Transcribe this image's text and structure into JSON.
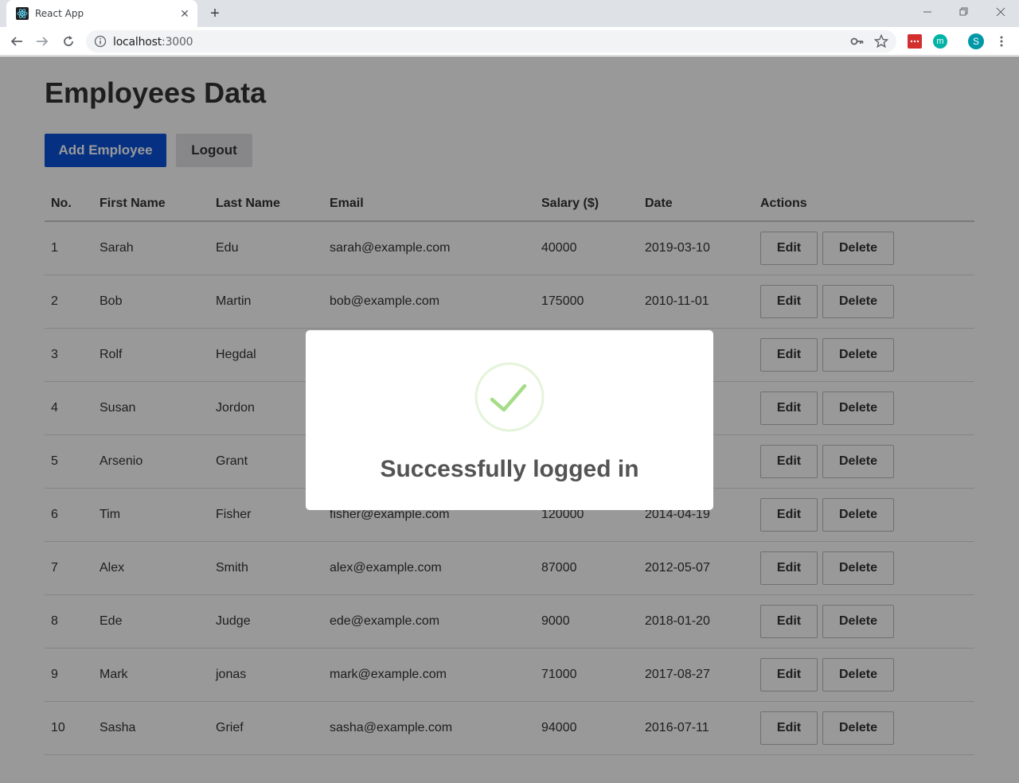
{
  "browser": {
    "tab_title": "React App",
    "url_host": "localhost",
    "url_port": ":3000",
    "profile_initial": "S",
    "extension_m": "m"
  },
  "page": {
    "title": "Employees Data",
    "add_button": "Add Employee",
    "logout_button": "Logout",
    "columns": [
      "No.",
      "First Name",
      "Last Name",
      "Email",
      "Salary ($)",
      "Date",
      "Actions"
    ],
    "edit_label": "Edit",
    "delete_label": "Delete",
    "rows": [
      {
        "no": "1",
        "first": "Sarah",
        "last": "Edu",
        "email": "sarah@example.com",
        "salary": "40000",
        "date": "2019-03-10"
      },
      {
        "no": "2",
        "first": "Bob",
        "last": "Martin",
        "email": "bob@example.com",
        "salary": "175000",
        "date": "2010-11-01"
      },
      {
        "no": "3",
        "first": "Rolf",
        "last": "Hegdal",
        "email": "",
        "salary": "",
        "date": ""
      },
      {
        "no": "4",
        "first": "Susan",
        "last": "Jordon",
        "email": "",
        "salary": "",
        "date": ""
      },
      {
        "no": "5",
        "first": "Arsenio",
        "last": "Grant",
        "email": "",
        "salary": "",
        "date": ""
      },
      {
        "no": "6",
        "first": "Tim",
        "last": "Fisher",
        "email": "fisher@example.com",
        "salary": "120000",
        "date": "2014-04-19"
      },
      {
        "no": "7",
        "first": "Alex",
        "last": "Smith",
        "email": "alex@example.com",
        "salary": "87000",
        "date": "2012-05-07"
      },
      {
        "no": "8",
        "first": "Ede",
        "last": "Judge",
        "email": "ede@example.com",
        "salary": "9000",
        "date": "2018-01-20"
      },
      {
        "no": "9",
        "first": "Mark",
        "last": "jonas",
        "email": "mark@example.com",
        "salary": "71000",
        "date": "2017-08-27"
      },
      {
        "no": "10",
        "first": "Sasha",
        "last": "Grief",
        "email": "sasha@example.com",
        "salary": "94000",
        "date": "2016-07-11"
      }
    ]
  },
  "modal": {
    "message": "Successfully logged in",
    "icon": "success-check-icon"
  },
  "colors": {
    "primary": "#0a53d9",
    "success": "#a5dc86"
  }
}
